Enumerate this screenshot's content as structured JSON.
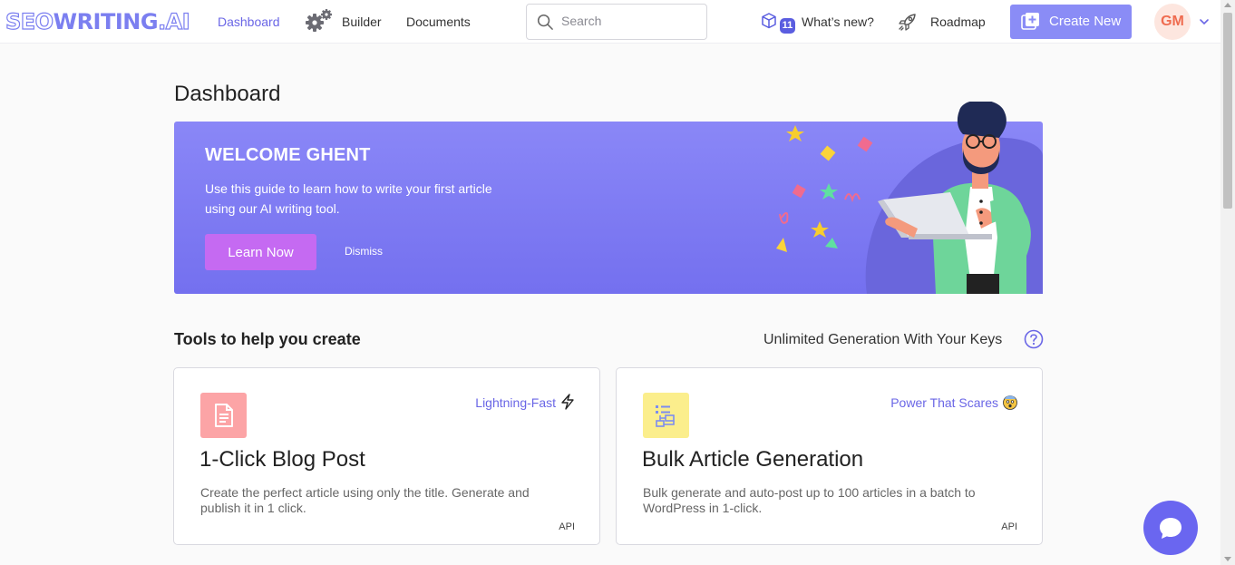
{
  "header": {
    "logo": {
      "part1": "SEO",
      "part2": "WRITING",
      "part3": ".AI"
    },
    "nav": {
      "dashboard": "Dashboard",
      "builder": "Builder",
      "documents": "Documents"
    },
    "search": {
      "placeholder": "Search",
      "value": ""
    },
    "whats_new": {
      "label": "What’s new?",
      "badge_count": "11"
    },
    "roadmap": {
      "label": "Roadmap"
    },
    "create_new": {
      "label": "Create New"
    },
    "user": {
      "initials": "GM"
    },
    "icons": [
      "gear-icon",
      "search-icon",
      "box-icon",
      "rocket-icon",
      "plus-square-icon",
      "chevron-down-icon"
    ]
  },
  "page": {
    "title": "Dashboard"
  },
  "banner": {
    "title": "WELCOME GHENT",
    "text": "Use this guide to learn how to write your first article using our AI writing tool.",
    "learn_button": "Learn Now",
    "dismiss_button": "Dismiss"
  },
  "tools": {
    "section_title": "Tools to help you create",
    "keys_label": "Unlimited Generation With Your Keys",
    "cards": [
      {
        "title": "1-Click Blog Post",
        "tag": "Lightning-Fast",
        "tag_icon": "lightning-icon",
        "description": "Create the perfect article using only the title. Generate and publish it in 1 click.",
        "api": "API",
        "icon": "document-icon"
      },
      {
        "title": "Bulk Article Generation",
        "tag": "Power That Scares",
        "tag_icon": "scared-face-icon",
        "description": "Bulk generate and auto-post up to 100 articles in a batch to WordPress in 1-click.",
        "api": "API",
        "icon": "flowchart-icon"
      }
    ]
  },
  "colors": {
    "accent": "#6a66e6",
    "banner": "#7c79f2",
    "learn_button": "#c56af2",
    "create_button": "#8a8cf6",
    "card1_icon_bg": "#fca4a6",
    "card2_icon_bg": "#fbee8c",
    "chat": "#6a66f0"
  }
}
